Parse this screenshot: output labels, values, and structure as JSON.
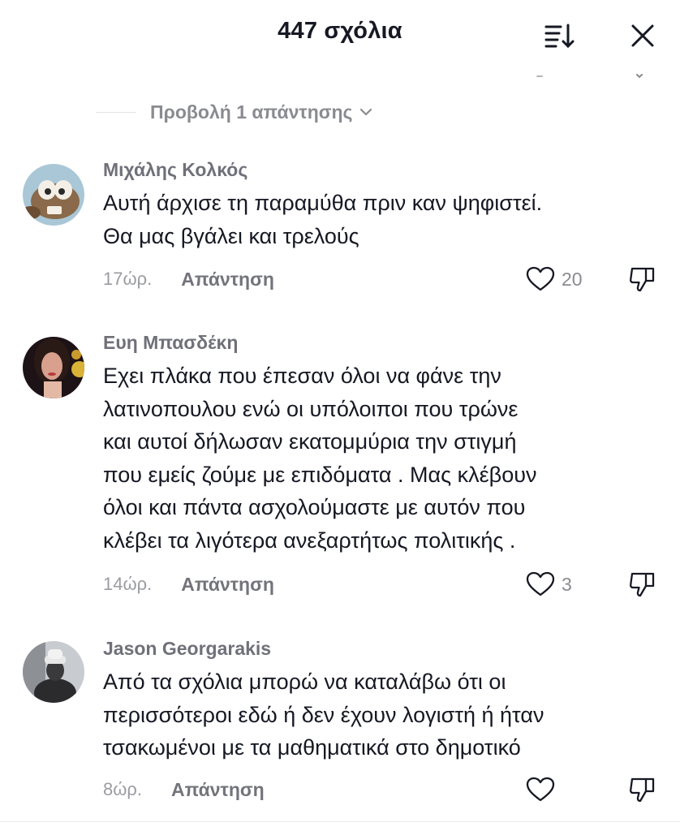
{
  "header": {
    "title": "447 σχόλια",
    "sort_icon": "sort-icon",
    "close_icon": "close-icon"
  },
  "view_replies": {
    "label": "Προβολή 1 απάντησης",
    "icon": "chevron-down-icon"
  },
  "comments": [
    {
      "username": "Μιχάλης Κολκός",
      "text_lines": [
        "Αυτή άρχισε τη παραμύθα πριν καν ψηφιστεί.",
        "Θα μας βγάλει και τρελούς"
      ],
      "time": "17ώρ.",
      "reply_label": "Απάντηση",
      "likes": "20"
    },
    {
      "username": "Ευη Μπασδέκη",
      "text_lines": [
        "Εχει πλάκα που έπεσαν όλοι να φάνε την",
        "λατινοπουλου ενώ οι υπόλοιποι που τρώνε",
        "και αυτοί δήλωσαν εκατομμύρια την στιγμή",
        "που εμείς ζούμε με επιδόματα . Μας κλέβουν",
        "όλοι και πάντα ασχολούμαστε με αυτόν που",
        "κλέβει τα λιγότερα ανεξαρτήτως πολιτικής ."
      ],
      "time": "14ώρ.",
      "reply_label": "Απάντηση",
      "likes": "3"
    },
    {
      "username": "Jason Georgarakis",
      "text_lines": [
        "Από τα σχόλια μπορώ να καταλάβω ότι οι",
        "περισσότεροι εδώ ή δεν έχουν λογιστή ή ήταν",
        "τσακωμένοι με τα μαθηματικά στο δημοτικό"
      ],
      "time": "8ώρ.",
      "reply_label": "Απάντηση",
      "likes": ""
    }
  ],
  "icons": {
    "like": "heart-icon",
    "dislike": "thumbs-down-icon"
  },
  "colors": {
    "text": "#161823",
    "muted": "#8a8b91",
    "username": "#6f7079",
    "background": "#ffffff"
  }
}
